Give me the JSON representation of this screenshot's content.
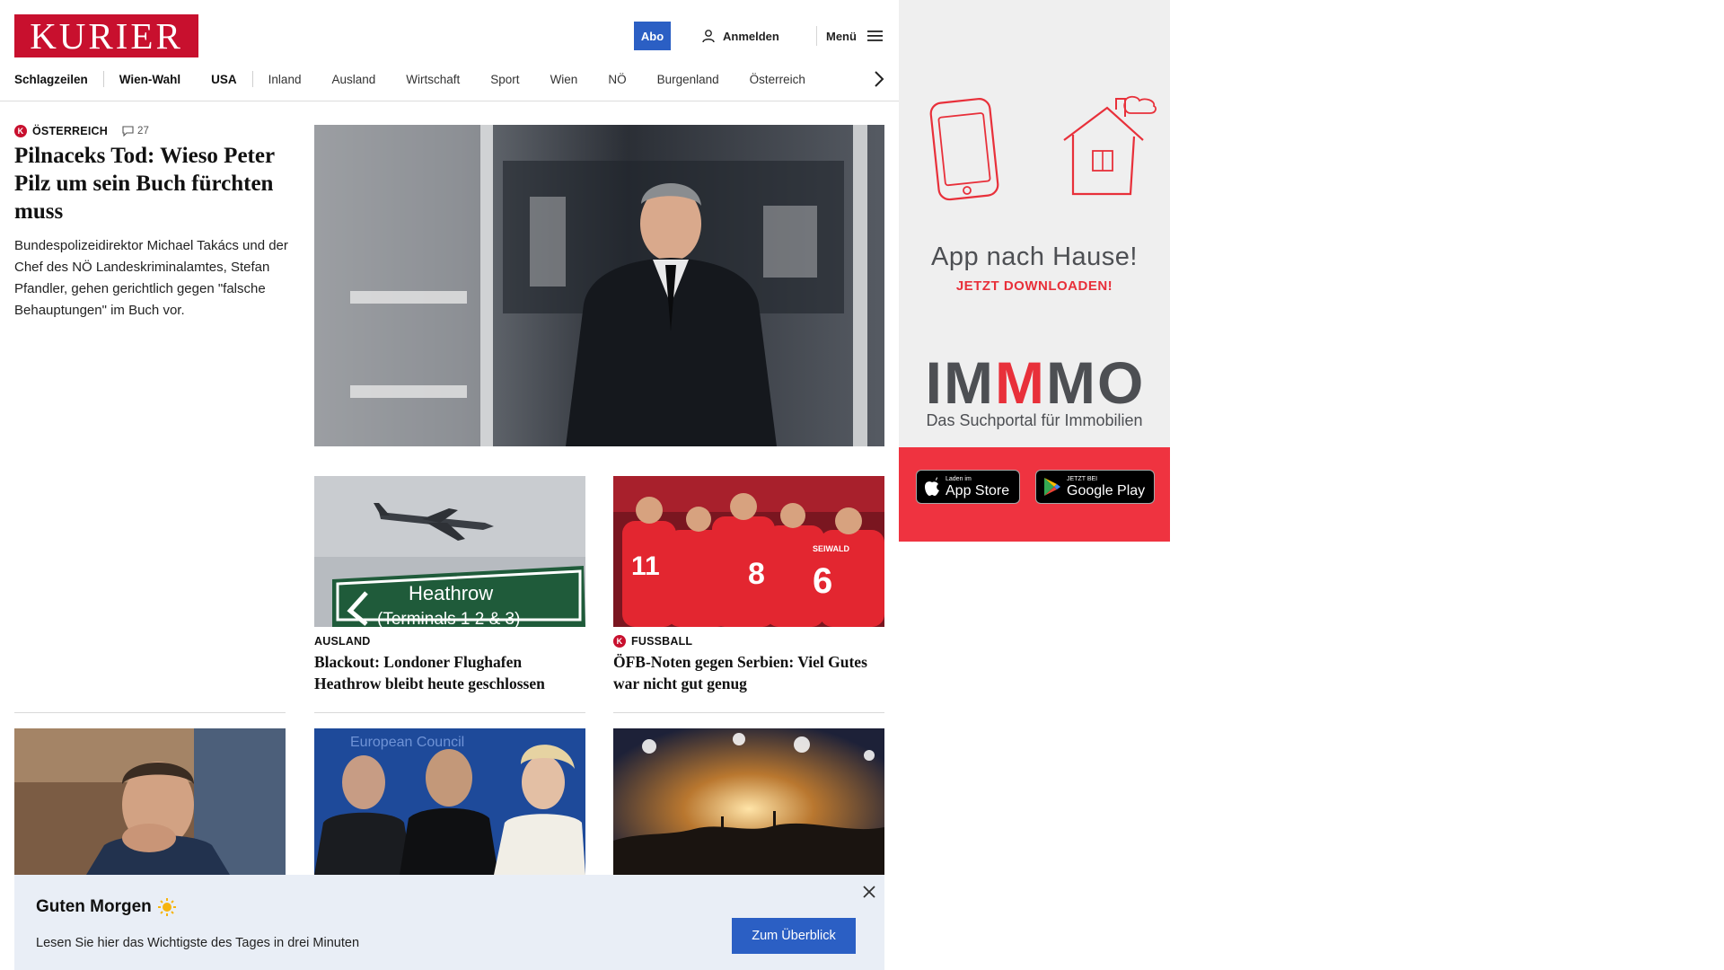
{
  "header": {
    "logo_text": "KURIER",
    "abo_label": "Abo",
    "login_label": "Anmelden",
    "menu_label": "Menü"
  },
  "nav": {
    "items": [
      "Schlagzeilen",
      "Wien-Wahl",
      "USA",
      "Inland",
      "Ausland",
      "Wirtschaft",
      "Sport",
      "Wien",
      "NÖ",
      "Burgenland",
      "Österreich"
    ]
  },
  "lead": {
    "kicker": "ÖSTERREICH",
    "comments": "27",
    "title": "Pilnaceks Tod: Wieso Peter Pilz um sein Buch fürchten muss",
    "teaser": "Bundespolizeidirektor Michael Takács und der Chef des NÖ Landeskriminalamtes, Stefan Pfandler, gehen gerichtlich gegen \"falsche Behauptungen\" im Buch vor."
  },
  "cards": [
    {
      "kicker": "AUSLAND",
      "title": "Blackout: Londoner Flughafen Heathrow bleibt heute geschlossen",
      "sign_line1": "Heathrow",
      "sign_line2": "(Terminals 1 2 & 3)"
    },
    {
      "kicker": "FUSSBALL",
      "title": "ÖFB-Noten gegen Serbien: Viel Gutes war nicht gut genug",
      "jersey_name": "SEIWALD",
      "jersey_numbers": [
        "11",
        "8",
        "6"
      ]
    }
  ],
  "bottom_images": {
    "council_sign": "European Council"
  },
  "ad": {
    "headline": "App nach Hause!",
    "cta": "JETZT DOWNLOADEN!",
    "brand_parts": [
      "IM",
      "M",
      "MO"
    ],
    "brand_tagline": "Das Suchportal für Immobilien",
    "appstore_small": "Laden im",
    "appstore_big": "App Store",
    "googleplay_small": "JETZT BEI",
    "googleplay_big": "Google Play"
  },
  "banner": {
    "title": "Guten Morgen",
    "text": "Lesen Sie hier das Wichtigste des Tages in drei Minuten",
    "button": "Zum Überblick"
  },
  "colors": {
    "brand_red": "#c8102e",
    "action_blue": "#2b5fc4",
    "ad_red": "#ef3340",
    "banner_bg": "#e9eef6"
  },
  "icons": [
    "user-icon",
    "hamburger-icon",
    "chevron-right-icon",
    "comment-icon",
    "close-icon",
    "sun-icon",
    "apple-icon",
    "google-play-icon"
  ]
}
